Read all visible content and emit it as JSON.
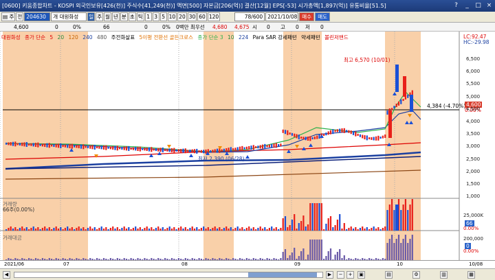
{
  "window": {
    "title": "[0600] 키움종합차트 - KOSPI 외국인보유[426(천)] 주식수[41,249(천)] 액면[500] 자본금[206(억)] 결산[12월] EPS[-53] 시가총액[1,897(억)] 유통비율[51.5]",
    "buttons": [
      "?",
      "_",
      "□",
      "×"
    ]
  },
  "toolbar": {
    "stock_code": "204630",
    "stock_name": "개 대원화성",
    "periods": [
      "일",
      "주",
      "월",
      "년",
      "분",
      "초",
      "틱"
    ],
    "minutes": [
      "1",
      "3",
      "5",
      "10",
      "20",
      "30",
      "60",
      "120"
    ],
    "count": "78/600",
    "date": "2021/10/08",
    "buy_label": "매수",
    "sell_label": "매도",
    "menu_left": "▤ 주",
    "menu_jeon": "전"
  },
  "quote": {
    "price": "4,600",
    "zero1": "0",
    "zero_pct": "0%",
    "vol": "66",
    "zero2": "0",
    "zero_pct2": "0%",
    "amount": "0백만",
    "priority": "최우선",
    "ask": "4,680",
    "bid": "4,675",
    "open_label": "시",
    "open": "0",
    "high_label": "고",
    "high": "0",
    "low_label": "저",
    "low": "0"
  },
  "legend": {
    "name": "대원화성",
    "ma_label": "종가 단순",
    "ma5": "5",
    "ma20": "20",
    "ma120": "120",
    "ma240": "240",
    "ma480": "480",
    "tri": "주전화살표",
    "golden": "5이평 전환선 골든크로스",
    "ma3": "종가 단순 3",
    "ma10": "10",
    "ma224": "224",
    "sar": "Para SAR 강세패턴",
    "weak": "약세패턴",
    "bollinger": "볼린저밴드",
    "lc": "LC:92.47",
    "hc": "HC:-29.98"
  },
  "annotations": {
    "high": "최고 6,570 (10/01)",
    "low": "최저 2,390 (06/28)",
    "last": "4,384 (-4.70%)",
    "cur_price": "4,600",
    "cur_pct": "0.00%"
  },
  "price_axis": [
    "6,500",
    "6,000",
    "5,500",
    "5,000",
    "4,500",
    "4,000",
    "3,500",
    "3,000",
    "2,500",
    "2,000",
    "1,500",
    "1,000"
  ],
  "volume": {
    "title": "거래량",
    "value": "66주(0.00%)",
    "axis": [
      "25,000K",
      "0.00%"
    ],
    "marker": "66"
  },
  "amount": {
    "title": "거래대금",
    "axis": [
      "200,000",
      "0.00%"
    ],
    "marker": "0"
  },
  "dates": [
    "2021/06",
    "07",
    "08",
    "09",
    "10",
    "10/08"
  ],
  "colors": {
    "up": "#e8201a",
    "down": "#1a4fd6",
    "highlight": "#f8c89a"
  }
}
